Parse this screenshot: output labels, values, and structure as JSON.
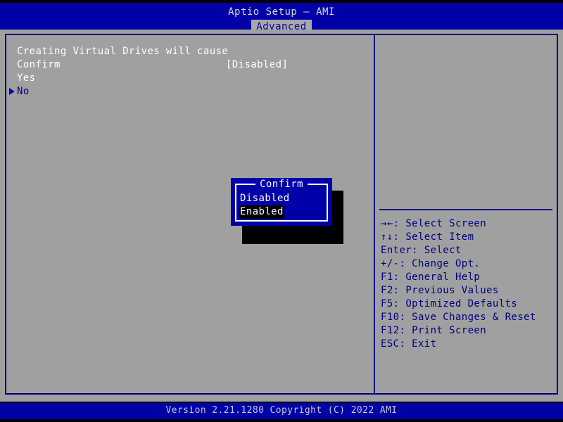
{
  "header": {
    "app_title": "Aptio Setup – AMI",
    "tabs": [
      {
        "label": "Advanced",
        "active": true
      }
    ]
  },
  "main": {
    "left_pane": {
      "rows": [
        {
          "label": "Creating Virtual Drives will cause",
          "value": "",
          "color": "white",
          "selected": false
        },
        {
          "label": "Confirm",
          "value": "[Disabled]",
          "color": "white",
          "selected": false
        },
        {
          "label": "Yes",
          "value": "",
          "color": "white",
          "selected": false
        },
        {
          "label": "No",
          "value": "",
          "color": "navy",
          "selected": true
        }
      ]
    },
    "right_pane": {
      "help_keys": [
        "→←: Select Screen",
        "↑↓: Select Item",
        "Enter: Select",
        "+/-: Change Opt.",
        "F1: General Help",
        "F2: Previous Values",
        "F5: Optimized Defaults",
        "F10: Save Changes & Reset",
        "F12: Print Screen",
        "ESC: Exit"
      ]
    }
  },
  "popup": {
    "title": "Confirm",
    "options": [
      {
        "label": "Disabled",
        "selected": false
      },
      {
        "label": "Enabled",
        "selected": true
      }
    ]
  },
  "footer": {
    "version_text": "Version 2.21.1280 Copyright (C) 2022 AMI"
  },
  "colors": {
    "header_blue": "#0000a8",
    "panel_gray": "#a0a0a0",
    "border_navy": "#000080",
    "text_white": "#ffffff",
    "text_navy": "#000080",
    "tab_active_bg": "#a8a8a8",
    "highlight_black": "#000000",
    "footer_text": "#c8c8c8"
  }
}
